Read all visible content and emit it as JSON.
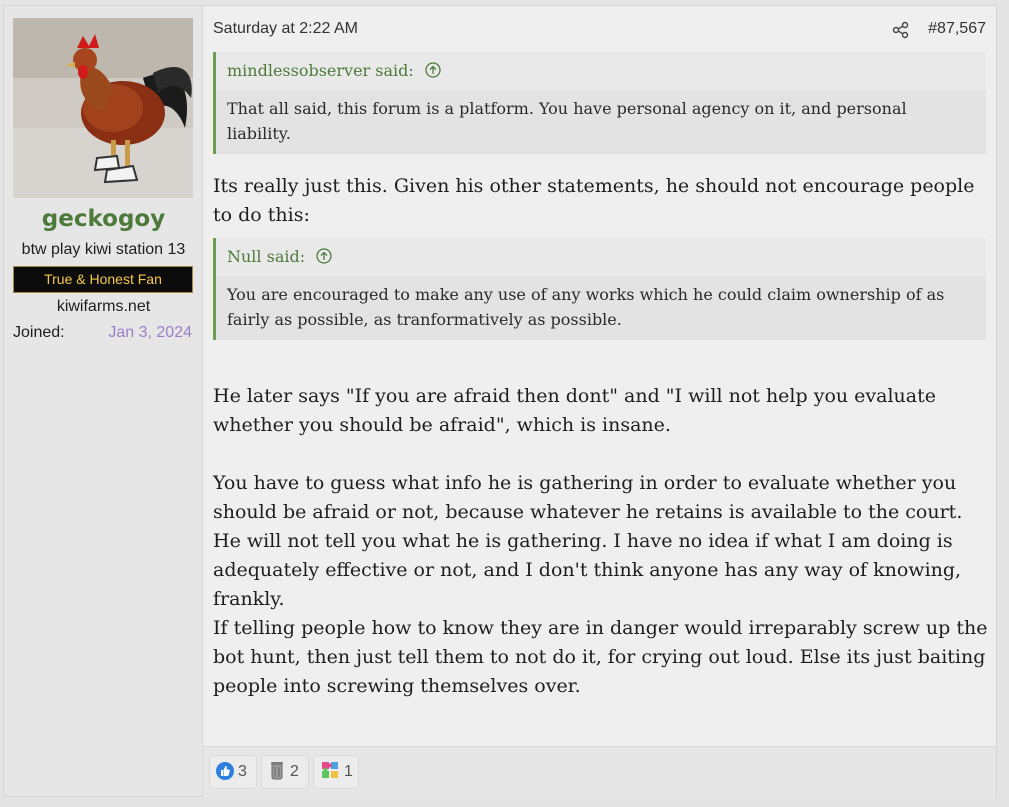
{
  "user": {
    "username": "geckogoy",
    "title": "btw play kiwi station 13",
    "banner": "True & Honest Fan",
    "site": "kiwifarms.net",
    "joined_label": "Joined:",
    "joined_date": "Jan 3, 2024"
  },
  "post": {
    "date": "Saturday at 2:22 AM",
    "number": "#87,567",
    "quote1": {
      "author": "mindlessobserver said:",
      "text": "That all said, this forum is a platform. You have personal agency on it, and personal liability."
    },
    "para1": "Its really just this. Given his other statements, he should not encourage people to do this:",
    "quote2": {
      "author": "Null said:",
      "text": "You are encouraged to make any use of any works which he could claim ownership of as fairly as possible, as tranformatively as possible."
    },
    "para2": "He later says \"If you are afraid then dont\" and \"I will not help you evaluate whether you should be afraid\", which is insane.",
    "para3": "You have to guess what info he is gathering in order to evaluate whether you should be afraid or not, because whatever he retains is available to the court. He will not tell you what he is gathering. I have no idea if what I am doing is adequately effective or not, and I don't think anyone has any way of knowing, frankly.",
    "para4": "If telling people how to know they are in danger would irreparably screw up the bot hunt, then just tell them to not do it, for crying out loud. Else its just baiting people into screwing themselves over."
  },
  "reactions": [
    {
      "icon": "thumbs-up-icon",
      "count": "3"
    },
    {
      "icon": "trash-can-icon",
      "count": "2"
    },
    {
      "icon": "puzzle-icon",
      "count": "1"
    }
  ],
  "colors": {
    "username": "#4d7a3a",
    "quote_border": "#6a9e4e",
    "banner_bg": "#0c0c0c",
    "banner_text": "#f4c84a",
    "joined_date": "#9b80c9"
  }
}
